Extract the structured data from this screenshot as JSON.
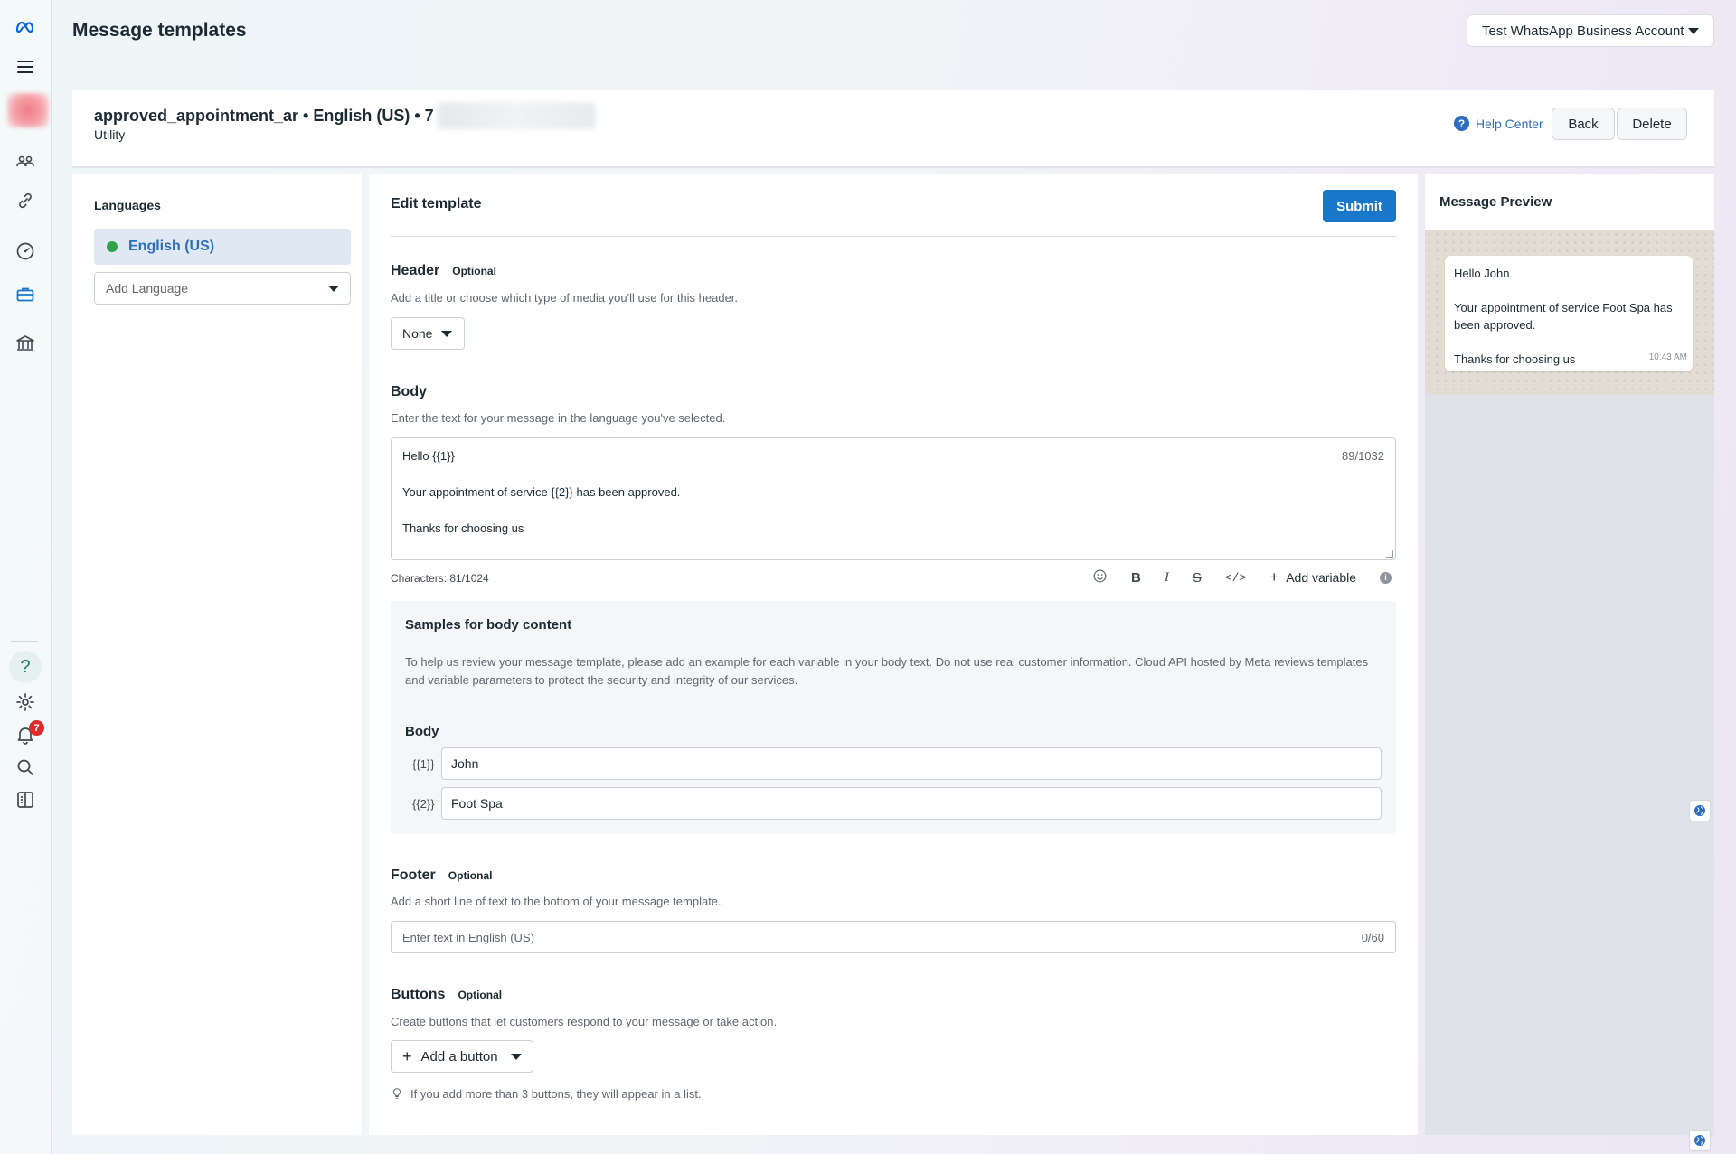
{
  "page": {
    "title": "Message templates"
  },
  "account": {
    "label": "Test WhatsApp Business Account"
  },
  "rail": {
    "icons": [
      "meta-logo-icon",
      "menu-icon",
      "people-icon",
      "link-icon",
      "dashboard-icon",
      "briefcase-icon",
      "bank-icon",
      "help-icon",
      "gear-icon",
      "bell-icon",
      "search-icon",
      "panel-toggle-icon"
    ],
    "notification_count": "7"
  },
  "template": {
    "name": "approved_appointment_ar • English (US) • 7",
    "category": "Utility",
    "help_center": "Help Center",
    "back_label": "Back",
    "delete_label": "Delete"
  },
  "languages": {
    "title": "Languages",
    "selected": "English (US)",
    "add_placeholder": "Add Language"
  },
  "editor": {
    "title": "Edit template",
    "submit_label": "Submit",
    "header": {
      "title": "Header",
      "optional": "Optional",
      "desc": "Add a title or choose which type of media you'll use for this header.",
      "type": "None"
    },
    "body": {
      "title": "Body",
      "desc": "Enter the text for your message in the language you've selected.",
      "lines": [
        "Hello {{1}}",
        "",
        "Your appointment of service {{2}} has been approved.",
        "",
        "Thanks for choosing us"
      ],
      "counter": "89/1032",
      "characters": "Characters: 81/1024",
      "add_variable": "Add variable"
    },
    "samples": {
      "title": "Samples for body content",
      "desc": "To help us review your message template, please add an example for each variable in your body text. Do not use real customer information. Cloud API hosted by Meta reviews templates and variable parameters to protect the security and integrity of our services.",
      "body_label": "Body",
      "vars": [
        {
          "label": "{{1}}",
          "value": "John"
        },
        {
          "label": "{{2}}",
          "value": "Foot Spa"
        }
      ]
    },
    "footer": {
      "title": "Footer",
      "optional": "Optional",
      "desc": "Add a short line of text to the bottom of your message template.",
      "placeholder": "Enter text in English (US)",
      "counter": "0/60"
    },
    "buttons": {
      "title": "Buttons",
      "optional": "Optional",
      "desc": "Create buttons that let customers respond to your message or take action.",
      "add_label": "Add a button",
      "tip": "If you add more than 3 buttons, they will appear in a list."
    }
  },
  "preview": {
    "title": "Message Preview",
    "lines": [
      "Hello John",
      "",
      "Your appointment of service Foot Spa has been approved.",
      "",
      "Thanks for choosing us"
    ],
    "time": "10:43 AM"
  },
  "colors": {
    "accent": "#1877c9",
    "link": "#2e6dbb",
    "online": "#2fa24a",
    "badge": "#e02a2a"
  }
}
